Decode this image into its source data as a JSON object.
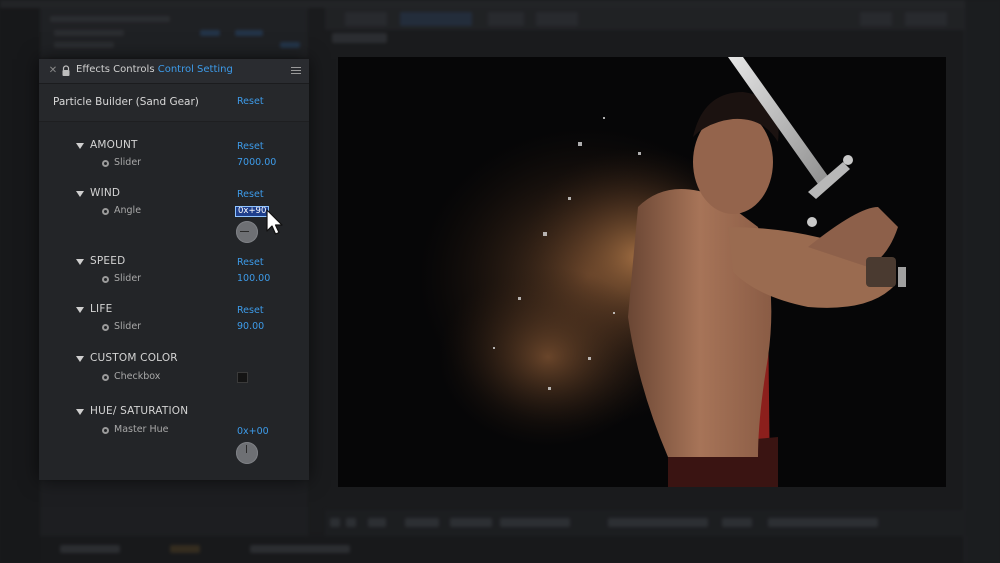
{
  "panel": {
    "title": "Effects Controls",
    "subtitle": "Control Setting",
    "close_icon": "close-icon",
    "lock_icon": "lock-icon",
    "menu_icon": "menu-icon"
  },
  "effect": {
    "name": "Particle Builder (Sand Gear)",
    "reset": "Reset"
  },
  "properties": [
    {
      "name": "AMOUNT",
      "reset": "Reset",
      "sub_label": "Slider",
      "value": "7000.00"
    },
    {
      "name": "WIND",
      "reset": "Reset",
      "sub_label": "Angle",
      "value": "0x+90.0°"
    },
    {
      "name": "SPEED",
      "reset": "Reset",
      "sub_label": "Slider",
      "value": "100.00"
    },
    {
      "name": "LIFE",
      "reset": "Reset",
      "sub_label": "Slider",
      "value": "90.00"
    },
    {
      "name": "CUSTOM COLOR",
      "sub_label": "Checkbox"
    },
    {
      "name": "HUE/ SATURATION",
      "sub_label": "Master Hue",
      "value": "0x+00"
    }
  ],
  "colors": {
    "accent": "#3d9be9",
    "panel_bg": "#232528",
    "selection": "#1f3f8c"
  }
}
